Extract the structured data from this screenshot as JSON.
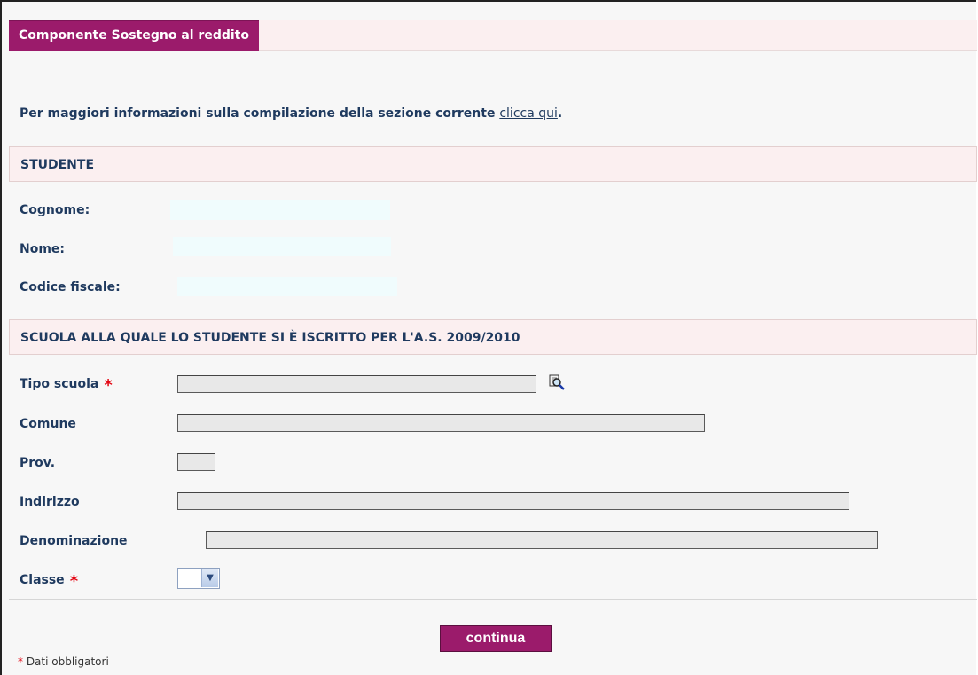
{
  "header": {
    "title": "Componente Sostegno al reddito"
  },
  "info": {
    "text": "Per maggiori informazioni sulla compilazione della sezione corrente ",
    "link": "clicca qui",
    "suffix": "."
  },
  "student": {
    "heading": "STUDENTE",
    "fields": [
      {
        "label": "Cognome:",
        "value": ""
      },
      {
        "label": "Nome:",
        "value": ""
      },
      {
        "label": "Codice fiscale:",
        "value": ""
      }
    ]
  },
  "school": {
    "heading": "SCUOLA ALLA QUALE LO STUDENTE SI È ISCRITTO PER L'A.S. 2009/2010",
    "tipo_scuola": {
      "label": "Tipo scuola",
      "value": "",
      "required": true
    },
    "comune": {
      "label": "Comune",
      "value": ""
    },
    "prov": {
      "label": "Prov.",
      "value": ""
    },
    "indirizzo": {
      "label": "Indirizzo",
      "value": ""
    },
    "denominazione": {
      "label": "Denominazione",
      "value": ""
    },
    "classe": {
      "label": "Classe",
      "value": "",
      "required": true
    }
  },
  "required_star": "*",
  "actions": {
    "continue_label": "continua"
  },
  "legend": {
    "star": "*",
    "text": " Dati obbligatori"
  },
  "colors": {
    "accent": "#9b1b6b",
    "section_bg": "#fbeff0",
    "required": "#e30613"
  },
  "icons": {
    "lookup": "magnifier-icon",
    "dropdown": "chevron-down-icon"
  }
}
